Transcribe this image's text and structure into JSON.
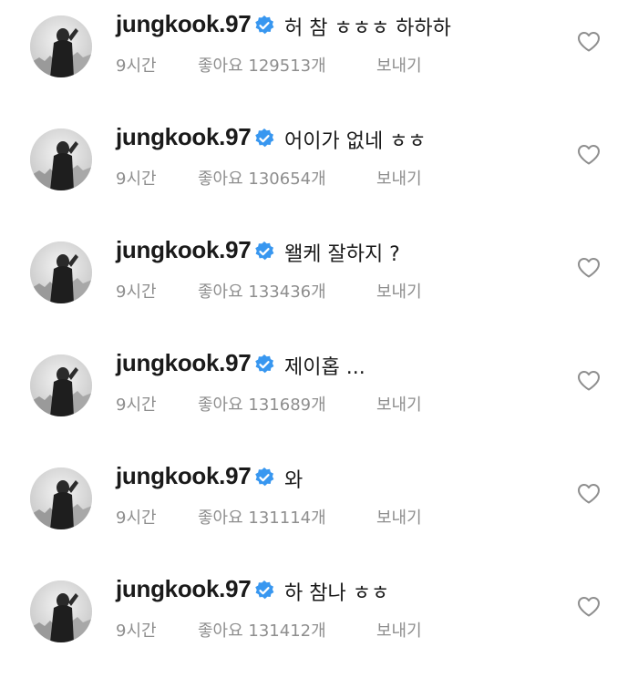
{
  "comments": [
    {
      "username": "jungkook.97",
      "text": "허 참 ㅎㅎㅎ 하하하",
      "time": "9시간",
      "likes": "좋아요 129513개",
      "reply": "보내기"
    },
    {
      "username": "jungkook.97",
      "text": "어이가 없네 ㅎㅎ",
      "time": "9시간",
      "likes": "좋아요 130654개",
      "reply": "보내기"
    },
    {
      "username": "jungkook.97",
      "text": "왤케 잘하지 ?",
      "time": "9시간",
      "likes": "좋아요 133436개",
      "reply": "보내기"
    },
    {
      "username": "jungkook.97",
      "text": "제이홉 ...",
      "time": "9시간",
      "likes": "좋아요 131689개",
      "reply": "보내기"
    },
    {
      "username": "jungkook.97",
      "text": "와",
      "time": "9시간",
      "likes": "좋아요 131114개",
      "reply": "보내기"
    },
    {
      "username": "jungkook.97",
      "text": "하 참나 ㅎㅎ",
      "time": "9시간",
      "likes": "좋아요 131412개",
      "reply": "보내기"
    }
  ],
  "colors": {
    "verified_badge": "#3897f0",
    "meta_text": "#8e8e8e",
    "username": "#1a1a1a",
    "heart_outline": "#8e8e8e"
  },
  "icons": {
    "verified": "verified-badge-icon",
    "like": "heart-outline-icon",
    "avatar": "profile-avatar"
  }
}
